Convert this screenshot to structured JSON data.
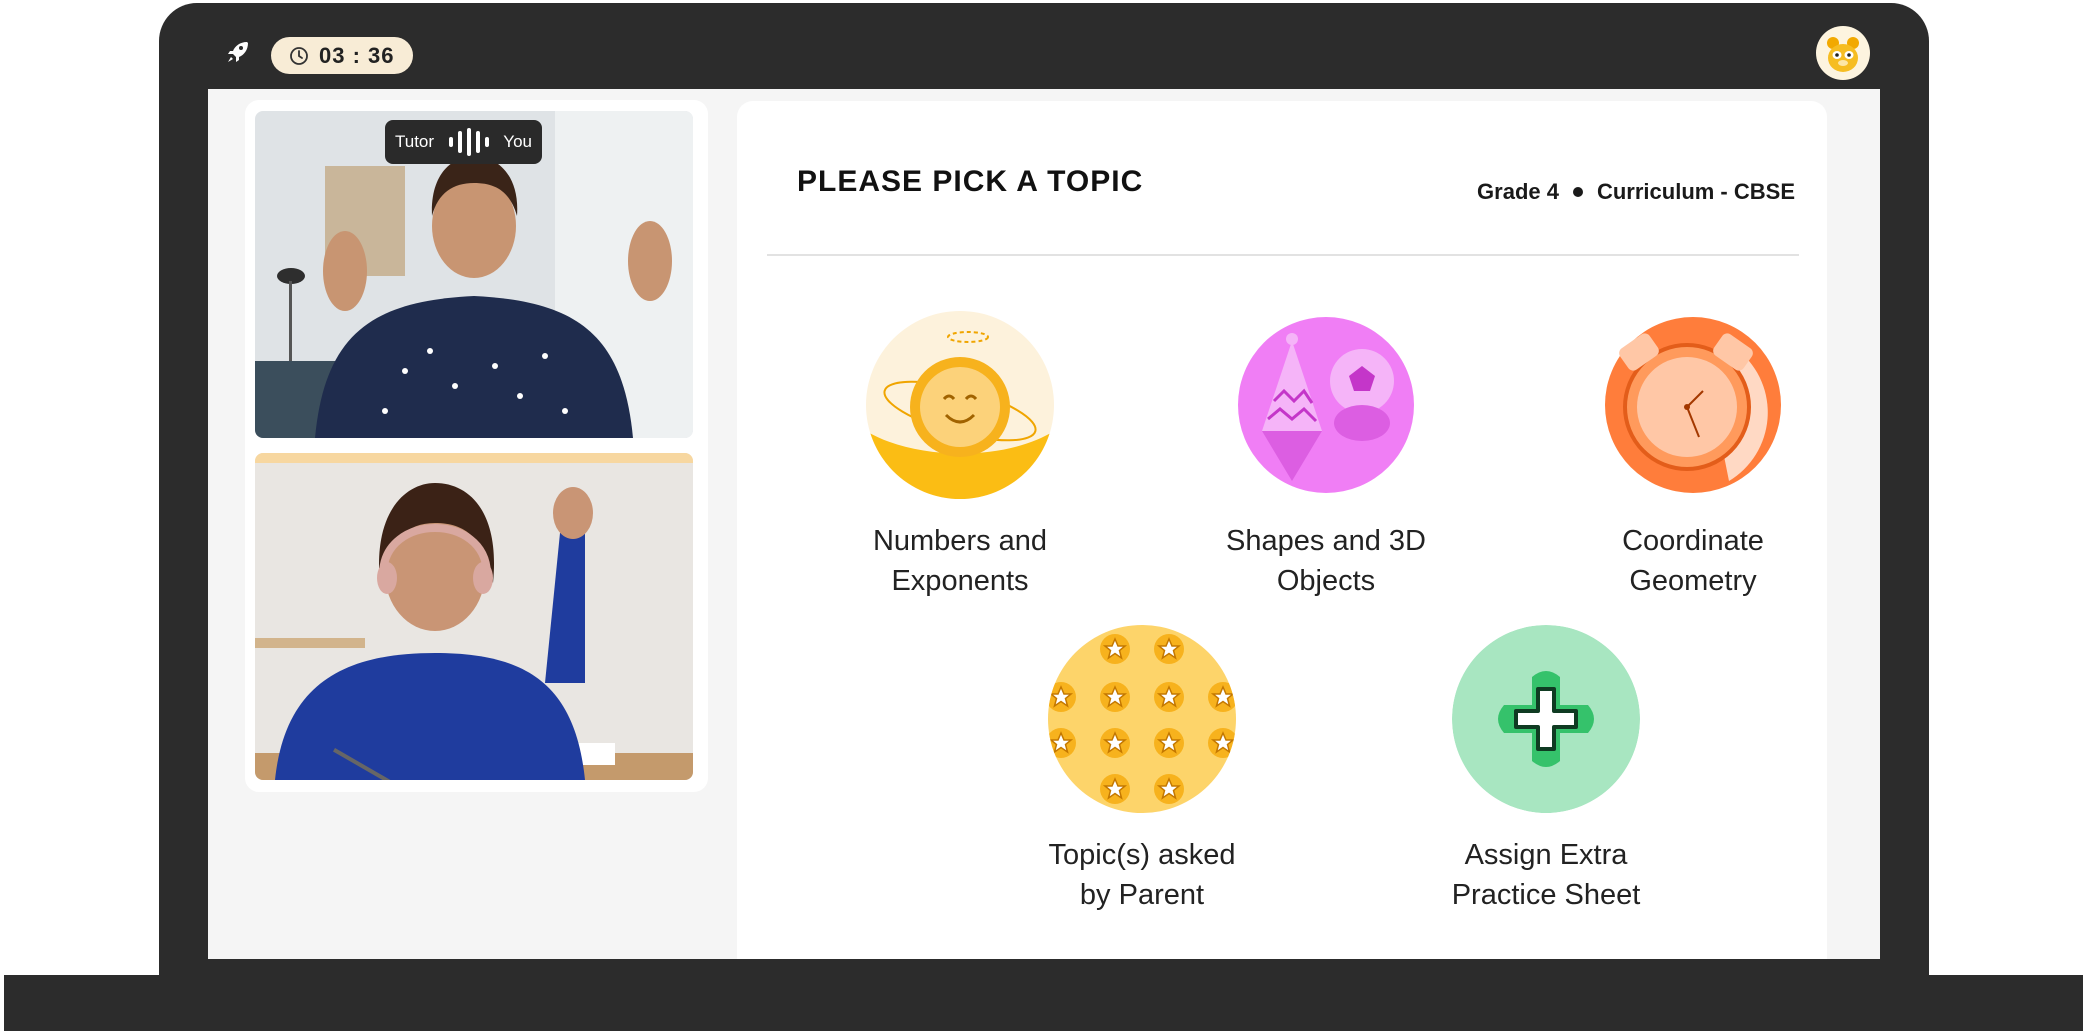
{
  "timer": {
    "value": "03 : 36"
  },
  "video_call": {
    "voice_indicator": {
      "left_label": "Tutor",
      "right_label": "You"
    }
  },
  "topic_picker": {
    "title": "PLEASE PICK A TOPIC",
    "grade": "Grade 4",
    "curriculum": "Curriculum - CBSE",
    "topics": [
      {
        "line1": "Numbers and",
        "line2": "Exponents",
        "icon": "smiling-coin-icon",
        "color": "#fbbd14"
      },
      {
        "line1": "Shapes and 3D",
        "line2": "Objects",
        "icon": "party-hat-and-ball-icon",
        "color": "#f07ef5"
      },
      {
        "line1": "Coordinate",
        "line2": "Geometry",
        "icon": "alarm-clock-icon",
        "color": "#ff7d3b"
      },
      {
        "line1": "Topic(s) asked",
        "line2": "by Parent",
        "icon": "stars-icon",
        "color": "#fdd46a"
      },
      {
        "line1": "Assign Extra",
        "line2": "Practice Sheet",
        "icon": "plus-icon",
        "color": "#a8e6c1"
      }
    ]
  }
}
